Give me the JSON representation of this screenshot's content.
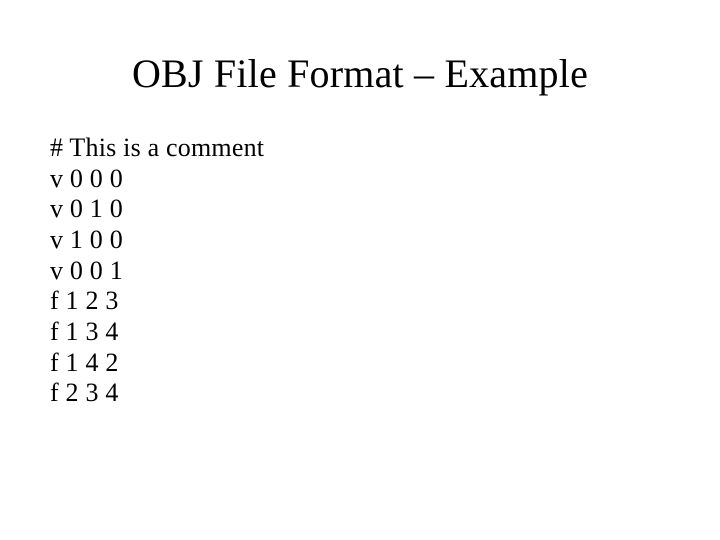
{
  "title": "OBJ File Format – Example",
  "lines": [
    "# This is a comment",
    "v 0 0 0",
    "v 0 1 0",
    "v 1 0 0",
    "v 0 0 1",
    "f 1 2 3",
    "f 1 3 4",
    "f 1 4 2",
    "f 2 3 4"
  ]
}
